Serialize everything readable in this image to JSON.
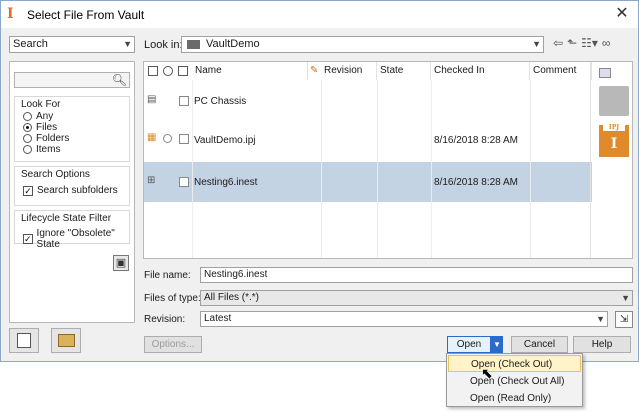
{
  "window": {
    "title": "Select File From Vault",
    "app_icon": "I"
  },
  "left": {
    "search_combo": "Search",
    "look_for": {
      "title": "Look For",
      "options": [
        "Any",
        "Files",
        "Folders",
        "Items"
      ],
      "selected": "Files"
    },
    "search_options": {
      "title": "Search Options",
      "subfolders_label": "Search subfolders",
      "subfolders_checked": true
    },
    "lifecycle": {
      "title": "Lifecycle State Filter",
      "ignore_label": "Ignore \"Obsolete\" State",
      "ignore_checked": true
    }
  },
  "lookin": {
    "label": "Look in:",
    "value": "VaultDemo"
  },
  "filelist": {
    "columns": [
      "Name",
      "Revision",
      "State",
      "Checked In",
      "Comment"
    ],
    "rows": [
      {
        "name": "PC Chassis",
        "checked_in": "",
        "icon": "folder-icon",
        "selected": false
      },
      {
        "name": "VaultDemo.ipj",
        "checked_in": "8/16/2018 8:28 AM",
        "icon": "ipj-file-icon",
        "selected": false
      },
      {
        "name": "Nesting6.inest",
        "checked_in": "8/16/2018 8:28 AM",
        "icon": "inest-file-icon",
        "selected": true
      }
    ],
    "thumb_ipj_letter": "I",
    "thumb_ipj_sub": "IPJ"
  },
  "form": {
    "filename_label": "File name:",
    "filename_value": "Nesting6.inest",
    "filetype_label": "Files of type:",
    "filetype_value": "All Files (*.*)",
    "revision_label": "Revision:",
    "revision_value": "Latest"
  },
  "buttons": {
    "options": "Options...",
    "open": "Open",
    "cancel": "Cancel",
    "help": "Help"
  },
  "menu": {
    "items": [
      "Open (Check Out)",
      "Open (Check Out All)",
      "Open (Read Only)"
    ],
    "hovered": "Open (Check Out)"
  }
}
